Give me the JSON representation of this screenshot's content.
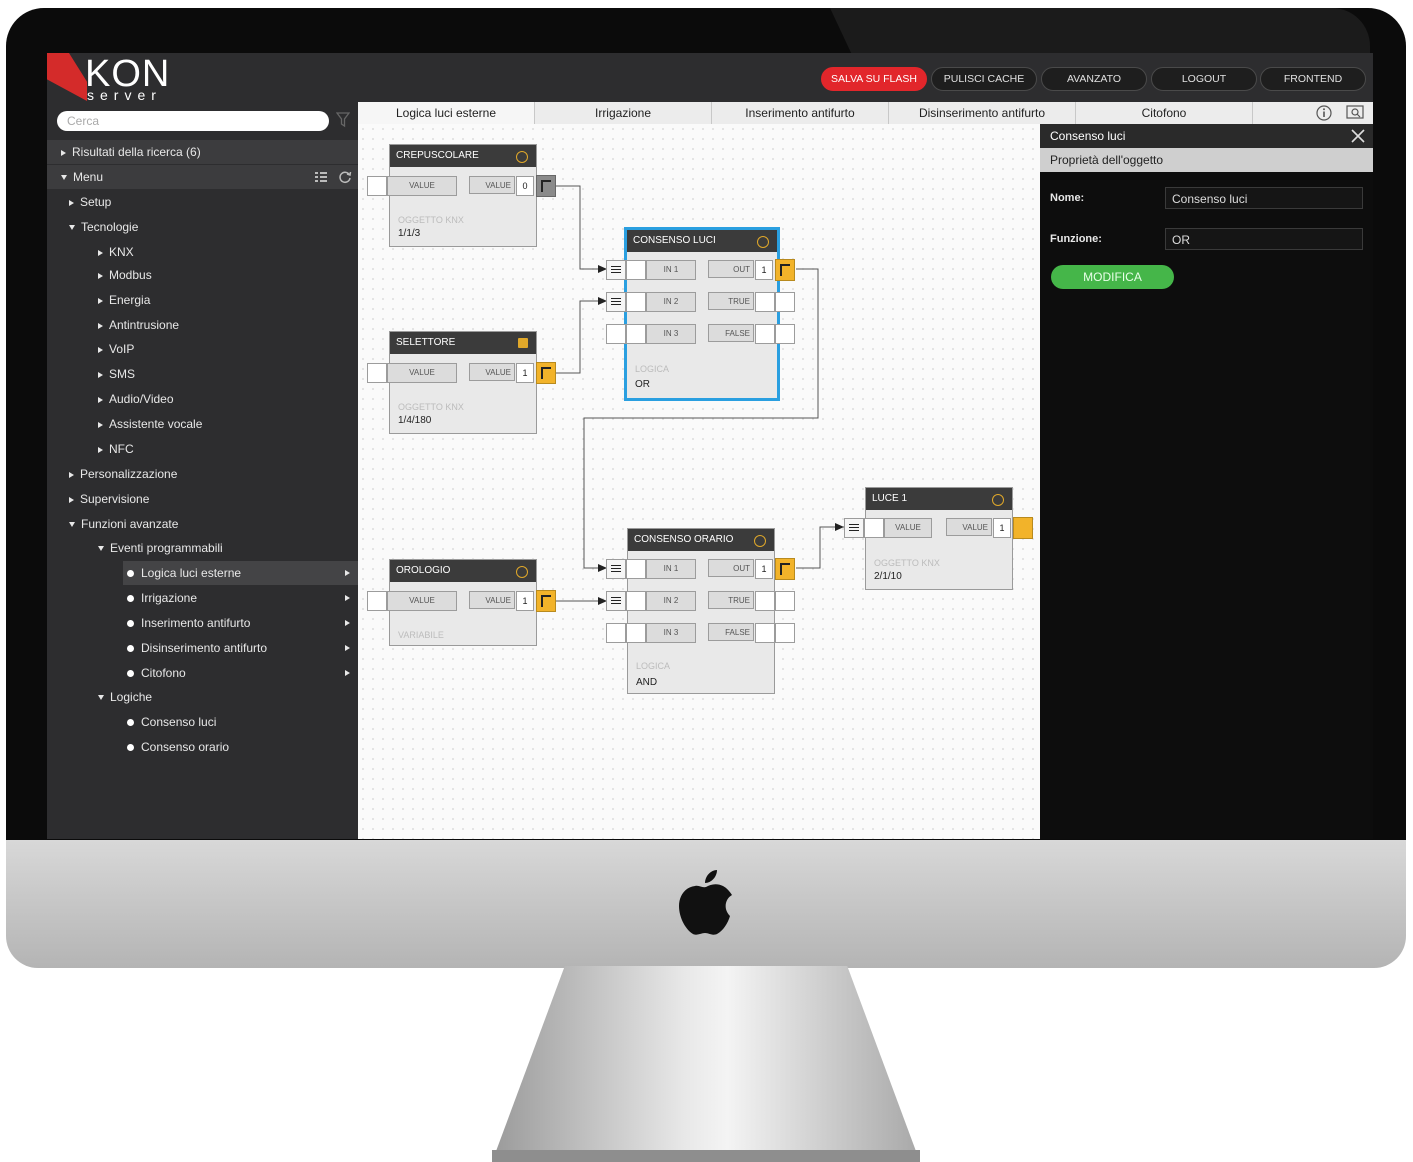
{
  "logo": {
    "main": "KON",
    "sub": "server"
  },
  "toolbar": {
    "buttons": [
      {
        "label": "SALVA SU FLASH",
        "color": "#e2262b"
      },
      {
        "label": "PULISCI CACHE"
      },
      {
        "label": "AVANZATO"
      },
      {
        "label": "LOGOUT"
      },
      {
        "label": "FRONTEND"
      }
    ]
  },
  "search": {
    "placeholder": "Cerca"
  },
  "tree": [
    {
      "label": "Risultati della ricerca (6)",
      "expanded": false
    },
    {
      "label": "Menu",
      "expanded": true
    },
    {
      "label": "Setup"
    },
    {
      "label": "Tecnologie",
      "expanded": true
    },
    {
      "label": "KNX"
    },
    {
      "label": "Modbus"
    },
    {
      "label": "Energia"
    },
    {
      "label": "Antintrusione"
    },
    {
      "label": "VoIP"
    },
    {
      "label": "SMS"
    },
    {
      "label": "Audio/Video"
    },
    {
      "label": "Assistente vocale"
    },
    {
      "label": "NFC"
    },
    {
      "label": "Personalizzazione"
    },
    {
      "label": "Supervisione"
    },
    {
      "label": "Funzioni avanzate",
      "expanded": true
    },
    {
      "label": "Eventi programmabili",
      "expanded": true
    },
    {
      "label": "Logica luci esterne",
      "selected": true
    },
    {
      "label": "Irrigazione"
    },
    {
      "label": "Inserimento antifurto"
    },
    {
      "label": "Disinserimento antifurto"
    },
    {
      "label": "Citofono"
    },
    {
      "label": "Logiche",
      "expanded": true
    },
    {
      "label": "Consenso luci"
    },
    {
      "label": "Consenso orario"
    }
  ],
  "tabs": [
    "Logica luci esterne",
    "Irrigazione",
    "Inserimento antifurto",
    "Disinserimento antifurto",
    "Citofono"
  ],
  "canvas": {
    "crepuscolare": {
      "title": "CREPUSCOLARE",
      "in": "VALUE",
      "out": "VALUE",
      "value": "0",
      "type": "OGGETTO KNX",
      "address": "1/1/3"
    },
    "selettore": {
      "title": "SELETTORE",
      "in": "VALUE",
      "out": "VALUE",
      "value": "1",
      "type": "OGGETTO KNX",
      "address": "1/4/180"
    },
    "orologio": {
      "title": "OROLOGIO",
      "in": "VALUE",
      "out": "VALUE",
      "value": "1",
      "type": "VARIABILE"
    },
    "consenso_luci": {
      "title": "CONSENSO LUCI",
      "in1": "IN 1",
      "in2": "IN 2",
      "in3": "IN 3",
      "out": "OUT",
      "true": "TRUE",
      "false": "FALSE",
      "value": "1",
      "type": "LOGICA",
      "func": "OR"
    },
    "consenso_orario": {
      "title": "CONSENSO ORARIO",
      "in1": "IN 1",
      "in2": "IN 2",
      "in3": "IN 3",
      "out": "OUT",
      "true": "TRUE",
      "false": "FALSE",
      "value": "1",
      "type": "LOGICA",
      "func": "AND"
    },
    "luce1": {
      "title": "LUCE 1",
      "in": "VALUE",
      "out": "VALUE",
      "value": "1",
      "type": "OGGETTO KNX",
      "address": "2/1/10"
    }
  },
  "properties": {
    "header": "Consenso luci",
    "section": "Proprietà dell'oggetto",
    "name_label": "Nome:",
    "name_value": "Consenso luci",
    "function_label": "Funzione:",
    "function_value": "OR",
    "button": "MODIFICA"
  },
  "colors": {
    "accent": "#f2b32a",
    "selection": "#2a9fe0",
    "modify": "#45b649",
    "brand": "#d42b2a"
  }
}
